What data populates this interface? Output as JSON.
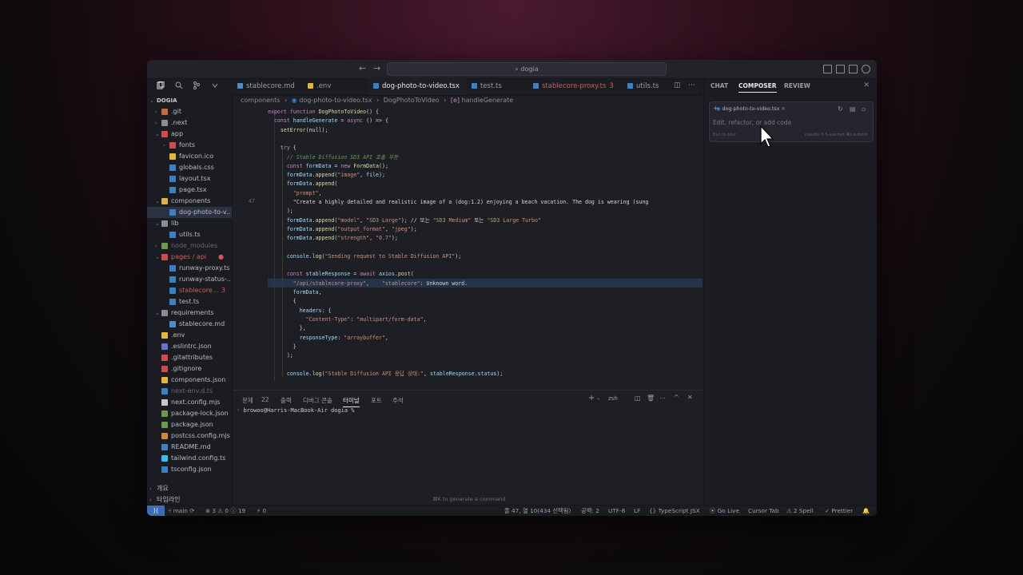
{
  "titlebar": {
    "search_text": "dogia"
  },
  "explorer": {
    "root_label": "DOGIA",
    "items": [
      {
        "label": ".git",
        "indent": 1,
        "type": "folder",
        "color": "#c46d3a",
        "dim": false
      },
      {
        "label": ".next",
        "indent": 1,
        "type": "folder",
        "color": "#8a8d96",
        "dim": false
      },
      {
        "label": "app",
        "indent": 1,
        "type": "folder-open",
        "color": "#d24b4b",
        "dim": false
      },
      {
        "label": "fonts",
        "indent": 2,
        "type": "folder",
        "color": "#d24b4b",
        "dim": false
      },
      {
        "label": "favicon.ico",
        "indent": 2,
        "type": "file",
        "color": "#e5b53b",
        "dim": false
      },
      {
        "label": "globals.css",
        "indent": 2,
        "type": "file",
        "color": "#3b82c4",
        "dim": false
      },
      {
        "label": "layout.tsx",
        "indent": 2,
        "type": "file",
        "color": "#3b82c4",
        "dim": false
      },
      {
        "label": "page.tsx",
        "indent": 2,
        "type": "file",
        "color": "#3b82c4",
        "dim": false
      },
      {
        "label": "components",
        "indent": 1,
        "type": "folder-open",
        "color": "#d8b34a",
        "dim": false
      },
      {
        "label": "dog-photo-to-v...",
        "indent": 2,
        "type": "file",
        "color": "#3b82c4",
        "dim": false,
        "selected": true
      },
      {
        "label": "lib",
        "indent": 1,
        "type": "folder-open",
        "color": "#8a8d96",
        "dim": false
      },
      {
        "label": "utils.ts",
        "indent": 2,
        "type": "file",
        "color": "#3b82c4",
        "dim": false
      },
      {
        "label": "node_modules",
        "indent": 1,
        "type": "folder",
        "color": "#6a9a4a",
        "dim": true
      },
      {
        "label": "pages / api",
        "indent": 1,
        "type": "folder-open",
        "color": "#d24b4b",
        "dim": false,
        "red": true
      },
      {
        "label": "runway-proxy.ts",
        "indent": 2,
        "type": "file",
        "color": "#3b82c4",
        "dim": false
      },
      {
        "label": "runway-status-...",
        "indent": 2,
        "type": "file",
        "color": "#3b82c4",
        "dim": false
      },
      {
        "label": "stablecore...",
        "indent": 2,
        "type": "file",
        "color": "#3b82c4",
        "dim": false,
        "red": true,
        "badge": "3"
      },
      {
        "label": "test.ts",
        "indent": 2,
        "type": "file",
        "color": "#3b82c4",
        "dim": false
      },
      {
        "label": "requirements",
        "indent": 1,
        "type": "folder-open",
        "color": "#8a8d96",
        "dim": false
      },
      {
        "label": "stablecore.md",
        "indent": 2,
        "type": "file",
        "color": "#4a90c4",
        "dim": false
      },
      {
        "label": ".env",
        "indent": 1,
        "type": "file",
        "color": "#e5b53b",
        "dim": false
      },
      {
        "label": ".eslintrc.json",
        "indent": 1,
        "type": "file",
        "color": "#6a6fd0",
        "dim": false
      },
      {
        "label": ".gitattributes",
        "indent": 1,
        "type": "file",
        "color": "#d24b4b",
        "dim": false
      },
      {
        "label": ".gitignore",
        "indent": 1,
        "type": "file",
        "color": "#d24b4b",
        "dim": false
      },
      {
        "label": "components.json",
        "indent": 1,
        "type": "file",
        "color": "#e5b53b",
        "dim": false
      },
      {
        "label": "next-env.d.ts",
        "indent": 1,
        "type": "file",
        "color": "#3b82c4",
        "dim": true
      },
      {
        "label": "next.config.mjs",
        "indent": 1,
        "type": "file",
        "color": "#c8c8c8",
        "dim": false
      },
      {
        "label": "package-lock.json",
        "indent": 1,
        "type": "file",
        "color": "#6a9a4a",
        "dim": false
      },
      {
        "label": "package.json",
        "indent": 1,
        "type": "file",
        "color": "#6a9a4a",
        "dim": false
      },
      {
        "label": "postcss.config.mjs",
        "indent": 1,
        "type": "file",
        "color": "#d2883b",
        "dim": false
      },
      {
        "label": "README.md",
        "indent": 1,
        "type": "file",
        "color": "#3b82c4",
        "dim": false
      },
      {
        "label": "tailwind.config.ts",
        "indent": 1,
        "type": "file",
        "color": "#38bdf8",
        "dim": false
      },
      {
        "label": "tsconfig.json",
        "indent": 1,
        "type": "file",
        "color": "#3b82c4",
        "dim": false
      }
    ],
    "outline_label": "개요",
    "timeline_label": "타임라인"
  },
  "tabs": [
    {
      "label": "stablecore.md",
      "color": "#4a90c4",
      "active": false,
      "red": false
    },
    {
      "label": ".env",
      "color": "#e5b53b",
      "active": false,
      "red": false
    },
    {
      "label": "dog-photo-to-video.tsx",
      "color": "#3b82c4",
      "active": true,
      "red": false
    },
    {
      "label": "test.ts",
      "color": "#3b82c4",
      "active": false,
      "red": false
    },
    {
      "label": "stablecore-proxy.ts",
      "color": "#3b82c4",
      "active": false,
      "red": true,
      "badge": "3"
    },
    {
      "label": "utils.ts",
      "color": "#3b82c4",
      "active": false,
      "red": false
    }
  ],
  "breadcrumbs": [
    "components",
    "dog-photo-to-video.tsx",
    "DogPhotoToVideo",
    "handleGenerate"
  ],
  "code_lines": [
    {
      "t": "export function DogPhotoToVideo() {",
      "i": 0
    },
    {
      "t": "  const handleGenerate = async () => {",
      "i": 0
    },
    {
      "t": "    setError(null);",
      "i": 0
    },
    {
      "t": "",
      "i": 0
    },
    {
      "t": "    try {",
      "i": 0
    },
    {
      "t": "      // Stable Diffusion SD3 API 호출 부분",
      "i": 0,
      "c": "comment"
    },
    {
      "t": "      const formData = new FormData();",
      "i": 0
    },
    {
      "t": "      formData.append(\"image\", file);",
      "i": 0
    },
    {
      "t": "      formData.append(",
      "i": 0
    },
    {
      "t": "        \"prompt\",",
      "i": 0
    },
    {
      "t": "        \"Create a highly detailed and realistic image of a (dog:1.2) enjoying a beach vacation. The dog is wearing (sung",
      "i": 0,
      "ln": "47"
    },
    {
      "t": "      );",
      "i": 0
    },
    {
      "t": "      formData.append(\"model\", \"SD3 Large\"); // 또는 \"SD3 Medium\" 또는 \"SD3 Large Turbo\"",
      "i": 0
    },
    {
      "t": "      formData.append(\"output_format\", \"jpeg\");",
      "i": 0
    },
    {
      "t": "      formData.append(\"strength\", \"0.7\");",
      "i": 0
    },
    {
      "t": "",
      "i": 0
    },
    {
      "t": "      console.log(\"Sending request to Stable Diffusion API\");",
      "i": 0
    },
    {
      "t": "",
      "i": 0
    },
    {
      "t": "      const stableResponse = await axios.post(",
      "i": 0
    },
    {
      "t": "        \"/api/stablecore-proxy\",    \"stablecore\": Unknown word.",
      "i": 0,
      "hl": true
    },
    {
      "t": "        formData,",
      "i": 0
    },
    {
      "t": "        {",
      "i": 0
    },
    {
      "t": "          headers: {",
      "i": 0
    },
    {
      "t": "            \"Content-Type\": \"multipart/form-data\",",
      "i": 0
    },
    {
      "t": "          },",
      "i": 0
    },
    {
      "t": "          responseType: \"arraybuffer\",",
      "i": 0
    },
    {
      "t": "        }",
      "i": 0
    },
    {
      "t": "      );",
      "i": 0
    },
    {
      "t": "",
      "i": 0
    },
    {
      "t": "      console.log(\"Stable Diffusion API 응답 상태:\", stableResponse.status);",
      "i": 0
    }
  ],
  "panel": {
    "tabs": [
      {
        "label": "문제",
        "active": false
      },
      {
        "label": "22",
        "active": false
      },
      {
        "label": "출력",
        "active": false
      },
      {
        "label": "디버그 콘솔",
        "active": false
      },
      {
        "label": "터미널",
        "active": true
      },
      {
        "label": "포트",
        "active": false
      },
      {
        "label": "주석",
        "active": false
      }
    ],
    "shell_label": "zsh",
    "terminal_prompt": "browoo@Harris-MacBook-Air dogia %",
    "hint": "⌘K to generate a command"
  },
  "right_panel": {
    "tabs": [
      {
        "label": "CHAT",
        "active": false
      },
      {
        "label": "COMPOSER",
        "active": true
      },
      {
        "label": "REVIEW",
        "active": false
      }
    ],
    "file_chip": "dog-photo-to-video.tsx",
    "placeholder": "Edit, refactor, or add code",
    "footer_left": "Esc to blur",
    "footer_right": "claude-3.5-sonnet  ⌘I submit"
  },
  "status": {
    "branch": "main",
    "problems": "⊗ 3 ⚠ 0 ⓘ 19",
    "ports": "⚡ 0",
    "position": "줄 47, 열 10(434 선택됨)",
    "spaces": "공백: 2",
    "encoding": "UTF-8",
    "eol": "LF",
    "language": "{} TypeScript JSX",
    "golive": "Go Live",
    "cursor_tab": "Cursor Tab",
    "spell": "2 Spell",
    "prettier": "✓ Prettier"
  },
  "colors": {
    "accent": "#3b6fb5",
    "error": "#e05555",
    "keyword": "#c586c0",
    "string": "#ce9178",
    "function": "#dcdcaa",
    "variable": "#9cdcfe",
    "comment": "#6a9955",
    "highlight": "#23344a"
  }
}
